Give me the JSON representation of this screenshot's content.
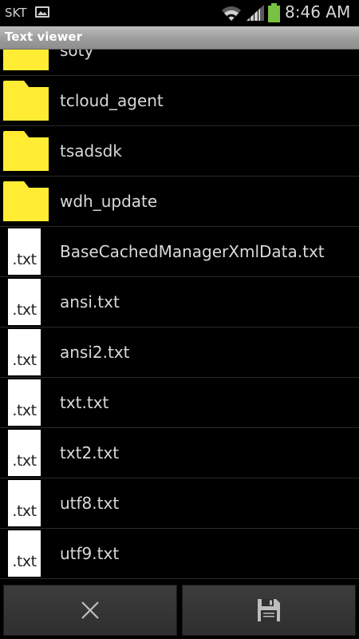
{
  "status_bar": {
    "carrier": "SKT",
    "time": "8:46 AM",
    "battery_color": "#79c140"
  },
  "title_bar": {
    "title": "Text viewer"
  },
  "file_list": {
    "folder_color": "#ffec33",
    "items": [
      {
        "type": "folder",
        "name": "soty"
      },
      {
        "type": "folder",
        "name": "tcloud_agent"
      },
      {
        "type": "folder",
        "name": "tsadsdk"
      },
      {
        "type": "folder",
        "name": "wdh_update"
      },
      {
        "type": "file",
        "name": "BaseCachedManagerXmlData.txt",
        "icon_text": ".txt"
      },
      {
        "type": "file",
        "name": "ansi.txt",
        "icon_text": ".txt"
      },
      {
        "type": "file",
        "name": "ansi2.txt",
        "icon_text": ".txt"
      },
      {
        "type": "file",
        "name": "txt.txt",
        "icon_text": ".txt"
      },
      {
        "type": "file",
        "name": "txt2.txt",
        "icon_text": ".txt"
      },
      {
        "type": "file",
        "name": "utf8.txt",
        "icon_text": ".txt"
      },
      {
        "type": "file",
        "name": "utf9.txt",
        "icon_text": ".txt"
      },
      {
        "type": "file",
        "name": "",
        "icon_text": ""
      }
    ]
  },
  "action_bar": {
    "cancel_icon": "close-icon",
    "save_icon": "save-icon"
  }
}
